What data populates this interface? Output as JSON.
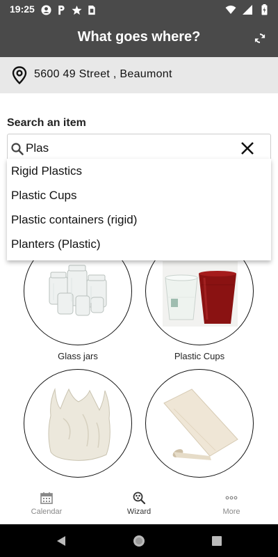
{
  "status_bar": {
    "time": "19:25",
    "left_icons": [
      "account-circle-icon",
      "parking-icon",
      "star-icon",
      "sim-icon"
    ],
    "right_icons": [
      "wifi-icon",
      "signal-icon",
      "battery-icon"
    ]
  },
  "app_bar": {
    "title": "What goes where?",
    "refresh_icon": "refresh-icon"
  },
  "location": {
    "icon": "location-pin-icon",
    "address": "5600 49 Street , Beaumont"
  },
  "search": {
    "label": "Search an item",
    "value": "Plas",
    "placeholder": "",
    "suggestions": [
      "Rigid Plastics",
      "Plastic Cups",
      "Plastic containers (rigid)",
      "Planters (Plastic)"
    ]
  },
  "items": [
    {
      "label": "Glass jars",
      "image": "glass-jars"
    },
    {
      "label": "Plastic Cups",
      "image": "plastic-cups"
    },
    {
      "label": "",
      "image": "plastic-bag"
    },
    {
      "label": "",
      "image": "paper-roll"
    }
  ],
  "bottom_nav": [
    {
      "label": "Calendar",
      "icon": "calendar-icon",
      "active": false
    },
    {
      "label": "Wizard",
      "icon": "wizard-search-icon",
      "active": true
    },
    {
      "label": "More",
      "icon": "more-dots-icon",
      "active": false
    }
  ],
  "colors": {
    "header_bg": "#4a4a4a",
    "address_bg": "#e8e8e8",
    "accent_red": "#b01818"
  }
}
